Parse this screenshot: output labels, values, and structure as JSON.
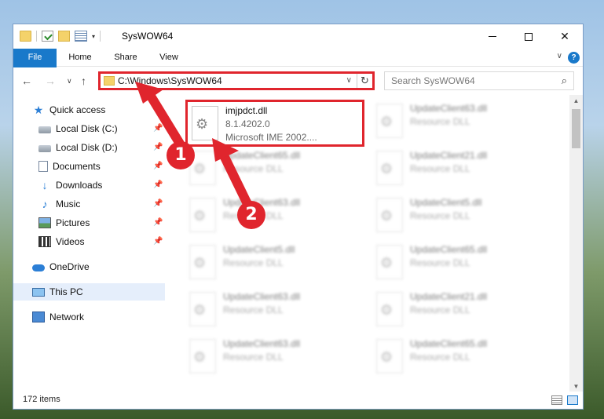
{
  "window": {
    "title": "SysWOW64",
    "minimize_icon": "minimize-icon",
    "maximize_icon": "maximize-icon",
    "close_glyph": "✕"
  },
  "ribbon": {
    "tabs": [
      "File",
      "Home",
      "Share",
      "View"
    ],
    "chevron": "∨",
    "help": "?"
  },
  "navigation": {
    "back": "←",
    "forward": "→",
    "recent": "∨",
    "up": "↑"
  },
  "address_bar": {
    "path": "C:\\Windows\\SysWOW64",
    "dropdown": "∨",
    "refresh": "↻"
  },
  "search": {
    "placeholder": "Search SysWOW64",
    "icon": "⌕"
  },
  "sidebar": {
    "items": [
      {
        "label": "Quick access",
        "icon": "star-icon",
        "glyph": "★",
        "pinned": false
      },
      {
        "label": "Local Disk (C:)",
        "icon": "disk-icon",
        "glyph": "",
        "pinned": true
      },
      {
        "label": "Local Disk (D:)",
        "icon": "disk-icon",
        "glyph": "",
        "pinned": true
      },
      {
        "label": "Documents",
        "icon": "documents-icon",
        "glyph": "",
        "pinned": true
      },
      {
        "label": "Downloads",
        "icon": "downloads-icon",
        "glyph": "↓",
        "pinned": true
      },
      {
        "label": "Music",
        "icon": "music-icon",
        "glyph": "♪",
        "pinned": true
      },
      {
        "label": "Pictures",
        "icon": "pictures-icon",
        "glyph": "",
        "pinned": true
      },
      {
        "label": "Videos",
        "icon": "videos-icon",
        "glyph": "",
        "pinned": true
      },
      {
        "label": "OneDrive",
        "icon": "onedrive-icon",
        "glyph": "",
        "pinned": false
      },
      {
        "label": "This PC",
        "icon": "this-pc-icon",
        "glyph": "",
        "pinned": false
      },
      {
        "label": "Network",
        "icon": "network-icon",
        "glyph": "",
        "pinned": false
      }
    ],
    "pin_glyph": "📌"
  },
  "files": [
    {
      "name": "imjpdct.dll",
      "version": "8.1.4202.0",
      "description": "Microsoft IME 2002....",
      "highlighted": true
    },
    {
      "name": "UpdateClient63.dll",
      "version": "",
      "description": "Resource DLL",
      "highlighted": false
    },
    {
      "name": "UpdateClient65.dll",
      "version": "",
      "description": "Resource DLL",
      "highlighted": false
    },
    {
      "name": "UpdateClient21.dll",
      "version": "",
      "description": "Resource DLL",
      "highlighted": false
    },
    {
      "name": "UpdateClient63.dll",
      "version": "",
      "description": "Resource DLL",
      "highlighted": false
    },
    {
      "name": "UpdateClient5.dll",
      "version": "",
      "description": "Resource DLL",
      "highlighted": false
    },
    {
      "name": "UpdateClient5.dll",
      "version": "",
      "description": "Resource DLL",
      "highlighted": false
    },
    {
      "name": "UpdateClient65.dll",
      "version": "",
      "description": "Resource DLL",
      "highlighted": false
    },
    {
      "name": "UpdateClient63.dll",
      "version": "",
      "description": "Resource DLL",
      "highlighted": false
    },
    {
      "name": "UpdateClient21.dll",
      "version": "",
      "description": "Resource DLL",
      "highlighted": false
    },
    {
      "name": "UpdateClient63.dll",
      "version": "",
      "description": "Resource DLL",
      "highlighted": false
    },
    {
      "name": "UpdateClient65.dll",
      "version": "",
      "description": "Resource DLL",
      "highlighted": false
    }
  ],
  "status": {
    "item_count": "172 items"
  },
  "annotations": {
    "callout_1": "1",
    "callout_2": "2",
    "color": "#e0252d"
  },
  "colors": {
    "accent": "#1979ca",
    "highlight_border": "#e0252d"
  }
}
